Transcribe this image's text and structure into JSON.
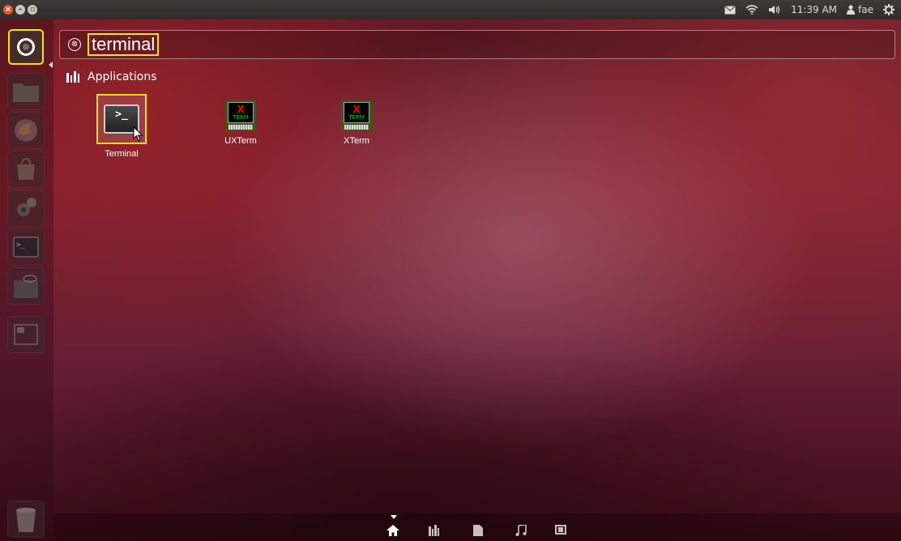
{
  "top_panel": {
    "window_buttons": [
      "close-icon",
      "minimize-icon",
      "maximize-icon"
    ],
    "indicators": {
      "mail_icon": "envelope-icon",
      "wifi_icon": "wifi-icon",
      "sound_icon": "speaker-icon",
      "time": "11:39 AM",
      "user_icon": "user-icon",
      "user": "fae",
      "session_icon": "gear-power-icon"
    }
  },
  "launcher": {
    "items": [
      "dash-home",
      "files",
      "firefox",
      "software-center",
      "system-settings",
      "terminal",
      "usb-drive",
      "workspace-switcher",
      "trash"
    ]
  },
  "search": {
    "clear_icon": "⊗",
    "query": "terminal"
  },
  "category": {
    "icon": "applications-icon",
    "label": "Applications"
  },
  "results": [
    {
      "label": "Terminal",
      "icon": "terminal-icon",
      "selected": true
    },
    {
      "label": "UXTerm",
      "icon": "xterm-icon"
    },
    {
      "label": "XTerm",
      "icon": "xterm-icon"
    }
  ],
  "filter_bar": {
    "items": [
      "home-icon",
      "applications-icon",
      "files-icon",
      "music-icon",
      "video-icon"
    ],
    "active": "home-icon"
  },
  "colors": {
    "highlight": "#f4e200",
    "panel": "#3c3b37",
    "close_button": "#e25a2c"
  }
}
